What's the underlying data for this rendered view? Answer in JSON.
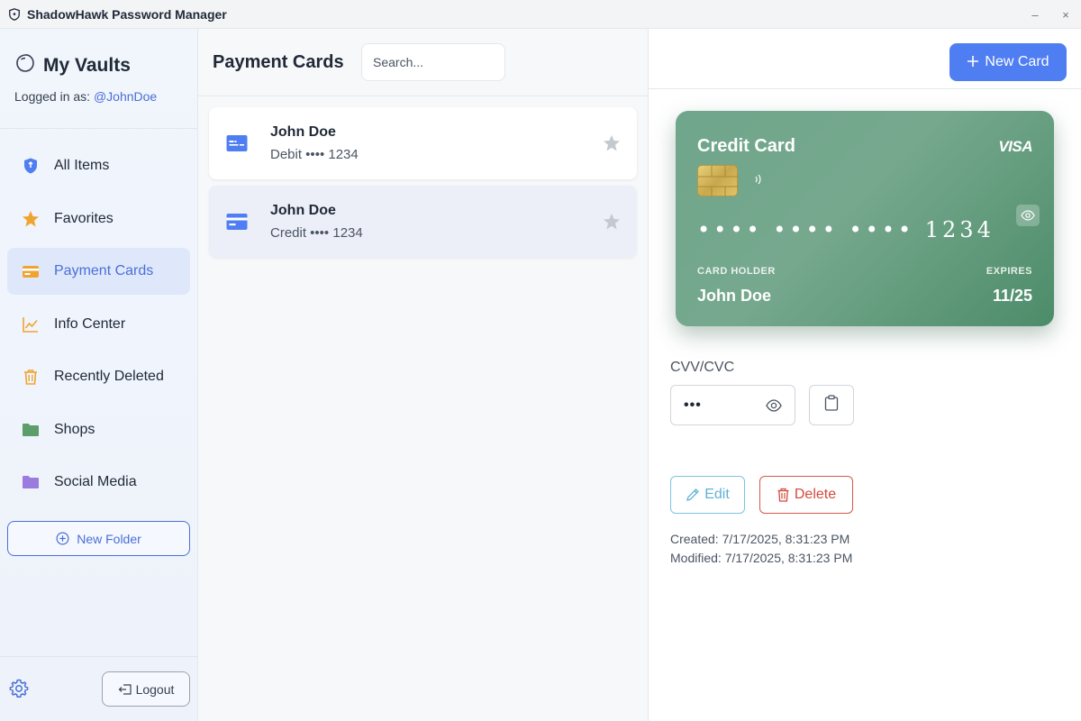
{
  "window": {
    "title": "ShadowHawk Password Manager",
    "minimize_glyph": "–",
    "close_glyph": "×"
  },
  "sidebar": {
    "vault_title": "My Vaults",
    "logged_in_prefix": "Logged in as: ",
    "username": "@JohnDoe",
    "items": [
      {
        "label": "All Items",
        "icon": "shield-icon",
        "color": "#4f7ef2"
      },
      {
        "label": "Favorites",
        "icon": "star-icon",
        "color": "#f0a430"
      },
      {
        "label": "Payment Cards",
        "icon": "credit-card-icon",
        "color": "#f0a430",
        "active": true
      },
      {
        "label": "Info Center",
        "icon": "chart-line-icon",
        "color": "#f0a430"
      },
      {
        "label": "Recently Deleted",
        "icon": "trash-icon",
        "color": "#f0a430"
      },
      {
        "label": "Shops",
        "icon": "folder-icon",
        "color": "#5b9e6a"
      },
      {
        "label": "Social Media",
        "icon": "folder-icon",
        "color": "#9b7be0"
      }
    ],
    "new_folder_label": "New Folder",
    "logout_label": "Logout"
  },
  "list": {
    "title": "Payment Cards",
    "search_placeholder": "Search...",
    "cards": [
      {
        "name": "John Doe",
        "subtitle": "Debit •••• 1234",
        "favorite": false
      },
      {
        "name": "John Doe",
        "subtitle": "Credit •••• 1234",
        "favorite": false,
        "selected": true
      }
    ]
  },
  "detail": {
    "new_card_label": "New Card",
    "card": {
      "type_label": "Credit Card",
      "brand": "VISA",
      "number_masked": "•••• •••• •••• 1234",
      "holder_label": "CARD HOLDER",
      "holder": "John Doe",
      "expires_label": "EXPIRES",
      "expires": "11/25"
    },
    "cvv_label": "CVV/CVC",
    "cvv_value": "•••",
    "edit_label": "Edit",
    "delete_label": "Delete",
    "created": "Created: 7/17/2025, 8:31:23 PM",
    "modified": "Modified: 7/17/2025, 8:31:23 PM"
  },
  "colors": {
    "accent": "#4f7ef2",
    "card_green": "#6fa68b",
    "delete_red": "#d24a3c",
    "edit_blue": "#5fb1d6"
  }
}
